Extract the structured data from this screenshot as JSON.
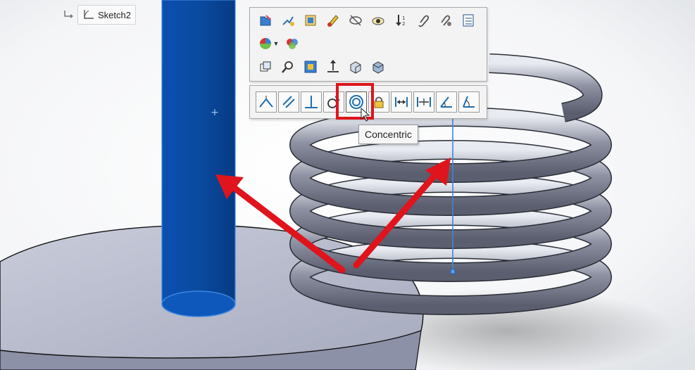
{
  "feature_tree": {
    "sketch_label": "Sketch2"
  },
  "context_toolbar": {
    "row1": [
      "edit-feature-icon",
      "edit-sketch-icon",
      "edit-part-icon",
      "appearance-icon",
      "hide-icon",
      "isolate-icon",
      "rollback-icon",
      "paperclip-icon",
      "mate-reference-icon",
      "properties-icon"
    ],
    "row2": [
      "appearance-palette-icon",
      "appearance-color-icon"
    ],
    "row3": [
      "view-orientation-icon",
      "zoom-selection-icon",
      "normal-to-icon",
      "move-icon",
      "section-view-icon",
      "display-style-icon"
    ]
  },
  "relations_toolbar": {
    "buttons": [
      "coincident-icon",
      "parallel-icon",
      "perpendicular-icon",
      "tangent-icon",
      "concentric-icon",
      "lock-icon",
      "distance-icon",
      "limit-distance-icon",
      "angle-icon",
      "angle-limit-icon"
    ],
    "active": "concentric-icon"
  },
  "tooltip": {
    "text": "Concentric"
  },
  "colors": {
    "highlight": "#e0141c",
    "selection_blue": "#0a4aa0",
    "arrow_red": "#e0141c"
  }
}
